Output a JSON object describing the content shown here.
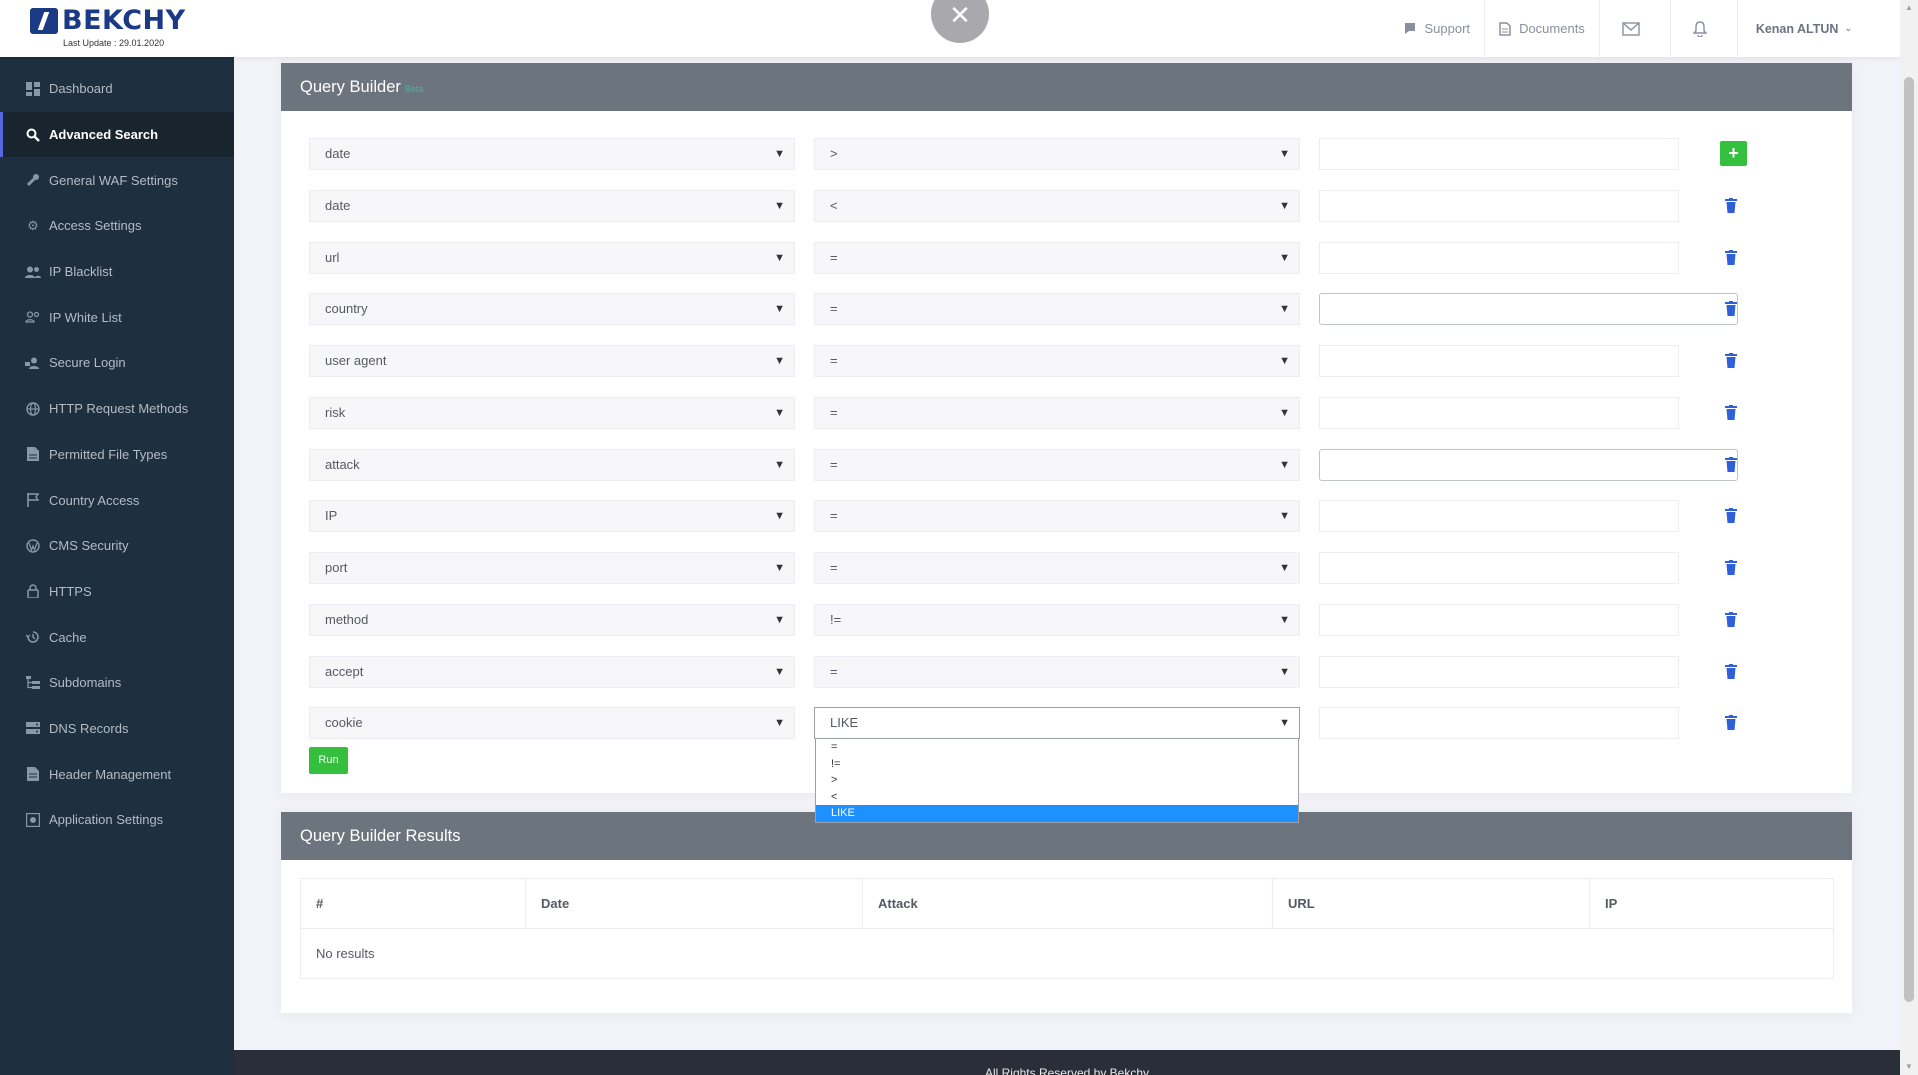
{
  "header": {
    "logo_text": "BEKCHY",
    "last_update": "Last Update : 29.01.2020",
    "close_glyph": "✕",
    "nav": [
      {
        "label": "Support",
        "icon": "chat-flag-icon"
      },
      {
        "label": "Documents",
        "icon": "document-icon"
      }
    ],
    "user_name": "Kenan ALTUN"
  },
  "sidebar": {
    "items": [
      {
        "label": "Dashboard",
        "icon": "dashboard-icon",
        "active": false
      },
      {
        "label": "Advanced Search",
        "icon": "search-icon",
        "active": true
      },
      {
        "label": "General WAF Settings",
        "icon": "wrench-icon",
        "active": false
      },
      {
        "label": "Access Settings",
        "icon": "gear-icon",
        "active": false
      },
      {
        "label": "IP Blacklist",
        "icon": "users-icon",
        "active": false
      },
      {
        "label": "IP White List",
        "icon": "users-outline-icon",
        "active": false
      },
      {
        "label": "Secure Login",
        "icon": "user-lock-icon",
        "active": false
      },
      {
        "label": "HTTP Request Methods",
        "icon": "globe-icon",
        "active": false
      },
      {
        "label": "Permitted File Types",
        "icon": "file-icon",
        "active": false
      },
      {
        "label": "Country Access",
        "icon": "flag-icon",
        "active": false
      },
      {
        "label": "CMS Security",
        "icon": "wordpress-icon",
        "active": false
      },
      {
        "label": "HTTPS",
        "icon": "lock-icon",
        "active": false
      },
      {
        "label": "Cache",
        "icon": "history-icon",
        "active": false
      },
      {
        "label": "Subdomains",
        "icon": "sitemap-icon",
        "active": false
      },
      {
        "label": "DNS Records",
        "icon": "server-icon",
        "active": false
      },
      {
        "label": "Header Management",
        "icon": "document-icon",
        "active": false
      },
      {
        "label": "Application Settings",
        "icon": "settings-box-icon",
        "active": false
      }
    ]
  },
  "query_builder": {
    "title": "Query Builder",
    "badge": "Beta",
    "rows": [
      {
        "field": "date",
        "operator": ">",
        "value": ""
      },
      {
        "field": "date",
        "operator": "<",
        "value": ""
      },
      {
        "field": "url",
        "operator": "=",
        "value": ""
      },
      {
        "field": "country",
        "operator": "=",
        "value": ""
      },
      {
        "field": "user agent",
        "operator": "=",
        "value": ""
      },
      {
        "field": "risk",
        "operator": "=",
        "value": ""
      },
      {
        "field": "attack",
        "operator": "=",
        "value": ""
      },
      {
        "field": "IP",
        "operator": "=",
        "value": ""
      },
      {
        "field": "port",
        "operator": "=",
        "value": ""
      },
      {
        "field": "method",
        "operator": "!=",
        "value": ""
      },
      {
        "field": "accept",
        "operator": "=",
        "value": ""
      },
      {
        "field": "cookie",
        "operator": "LIKE",
        "value": ""
      }
    ],
    "operator_options": [
      "=",
      "!=",
      ">",
      "<",
      "LIKE"
    ],
    "add_label": "+",
    "run_label": "Run"
  },
  "results": {
    "title": "Query Builder Results",
    "columns": [
      "#",
      "Date",
      "Attack",
      "URL",
      "IP"
    ],
    "empty_text": "No results"
  },
  "footer": {
    "text": "All Rights Reserved by Bekchy"
  },
  "colors": {
    "sidebar_bg": "#1e2f3f",
    "header_gray": "#6c747d",
    "accent_green": "#34bf3f",
    "delete_blue": "#2f5fd9",
    "dropdown_highlight": "#1e90ff"
  }
}
